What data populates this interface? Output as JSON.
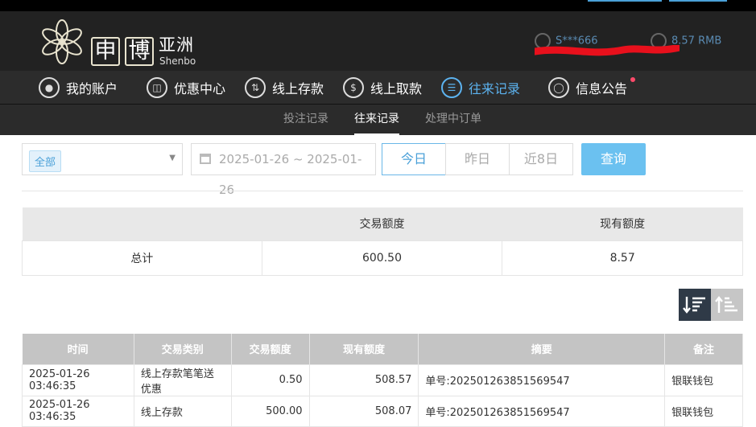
{
  "brand": {
    "box1": "申",
    "box2": "博",
    "cn": "亚洲",
    "en": "Shenbo"
  },
  "user": {
    "name": "S***666",
    "balance": "8.57 RMB"
  },
  "nav": [
    {
      "label": "我的账户",
      "icon": "user-icon"
    },
    {
      "label": "优惠中心",
      "icon": "gift-icon"
    },
    {
      "label": "线上存款",
      "icon": "deposit-icon"
    },
    {
      "label": "线上取款",
      "icon": "withdraw-icon"
    },
    {
      "label": "往来记录",
      "icon": "record-icon"
    },
    {
      "label": "信息公告",
      "icon": "bell-icon"
    }
  ],
  "subnav": [
    "投注记录",
    "往来记录",
    "处理中订单"
  ],
  "filter": {
    "type_tag": "全部",
    "date_range": "2025-01-26 ~ 2025-01-26",
    "today": "今日",
    "yesterday": "昨日",
    "last8": "近8日",
    "query": "查询"
  },
  "summary": {
    "headers": [
      "",
      "交易额度",
      "现有额度"
    ],
    "row": [
      "总计",
      "600.50",
      "8.57"
    ]
  },
  "detail": {
    "headers": [
      "时间",
      "交易类别",
      "交易额度",
      "现有额度",
      "摘要",
      "备注"
    ],
    "rows": [
      [
        "2025-01-26 03:46:35",
        "线上存款笔笔送优惠",
        "0.50",
        "508.57",
        "单号:202501263851569547",
        "银联钱包"
      ],
      [
        "2025-01-26 03:46:35",
        "线上存款",
        "500.00",
        "508.07",
        "单号:202501263851569547",
        "银联钱包"
      ]
    ]
  },
  "colors": {
    "accent": "#5cb3f0",
    "header_bg": "#222222",
    "query_btn": "#6bc1f0"
  }
}
